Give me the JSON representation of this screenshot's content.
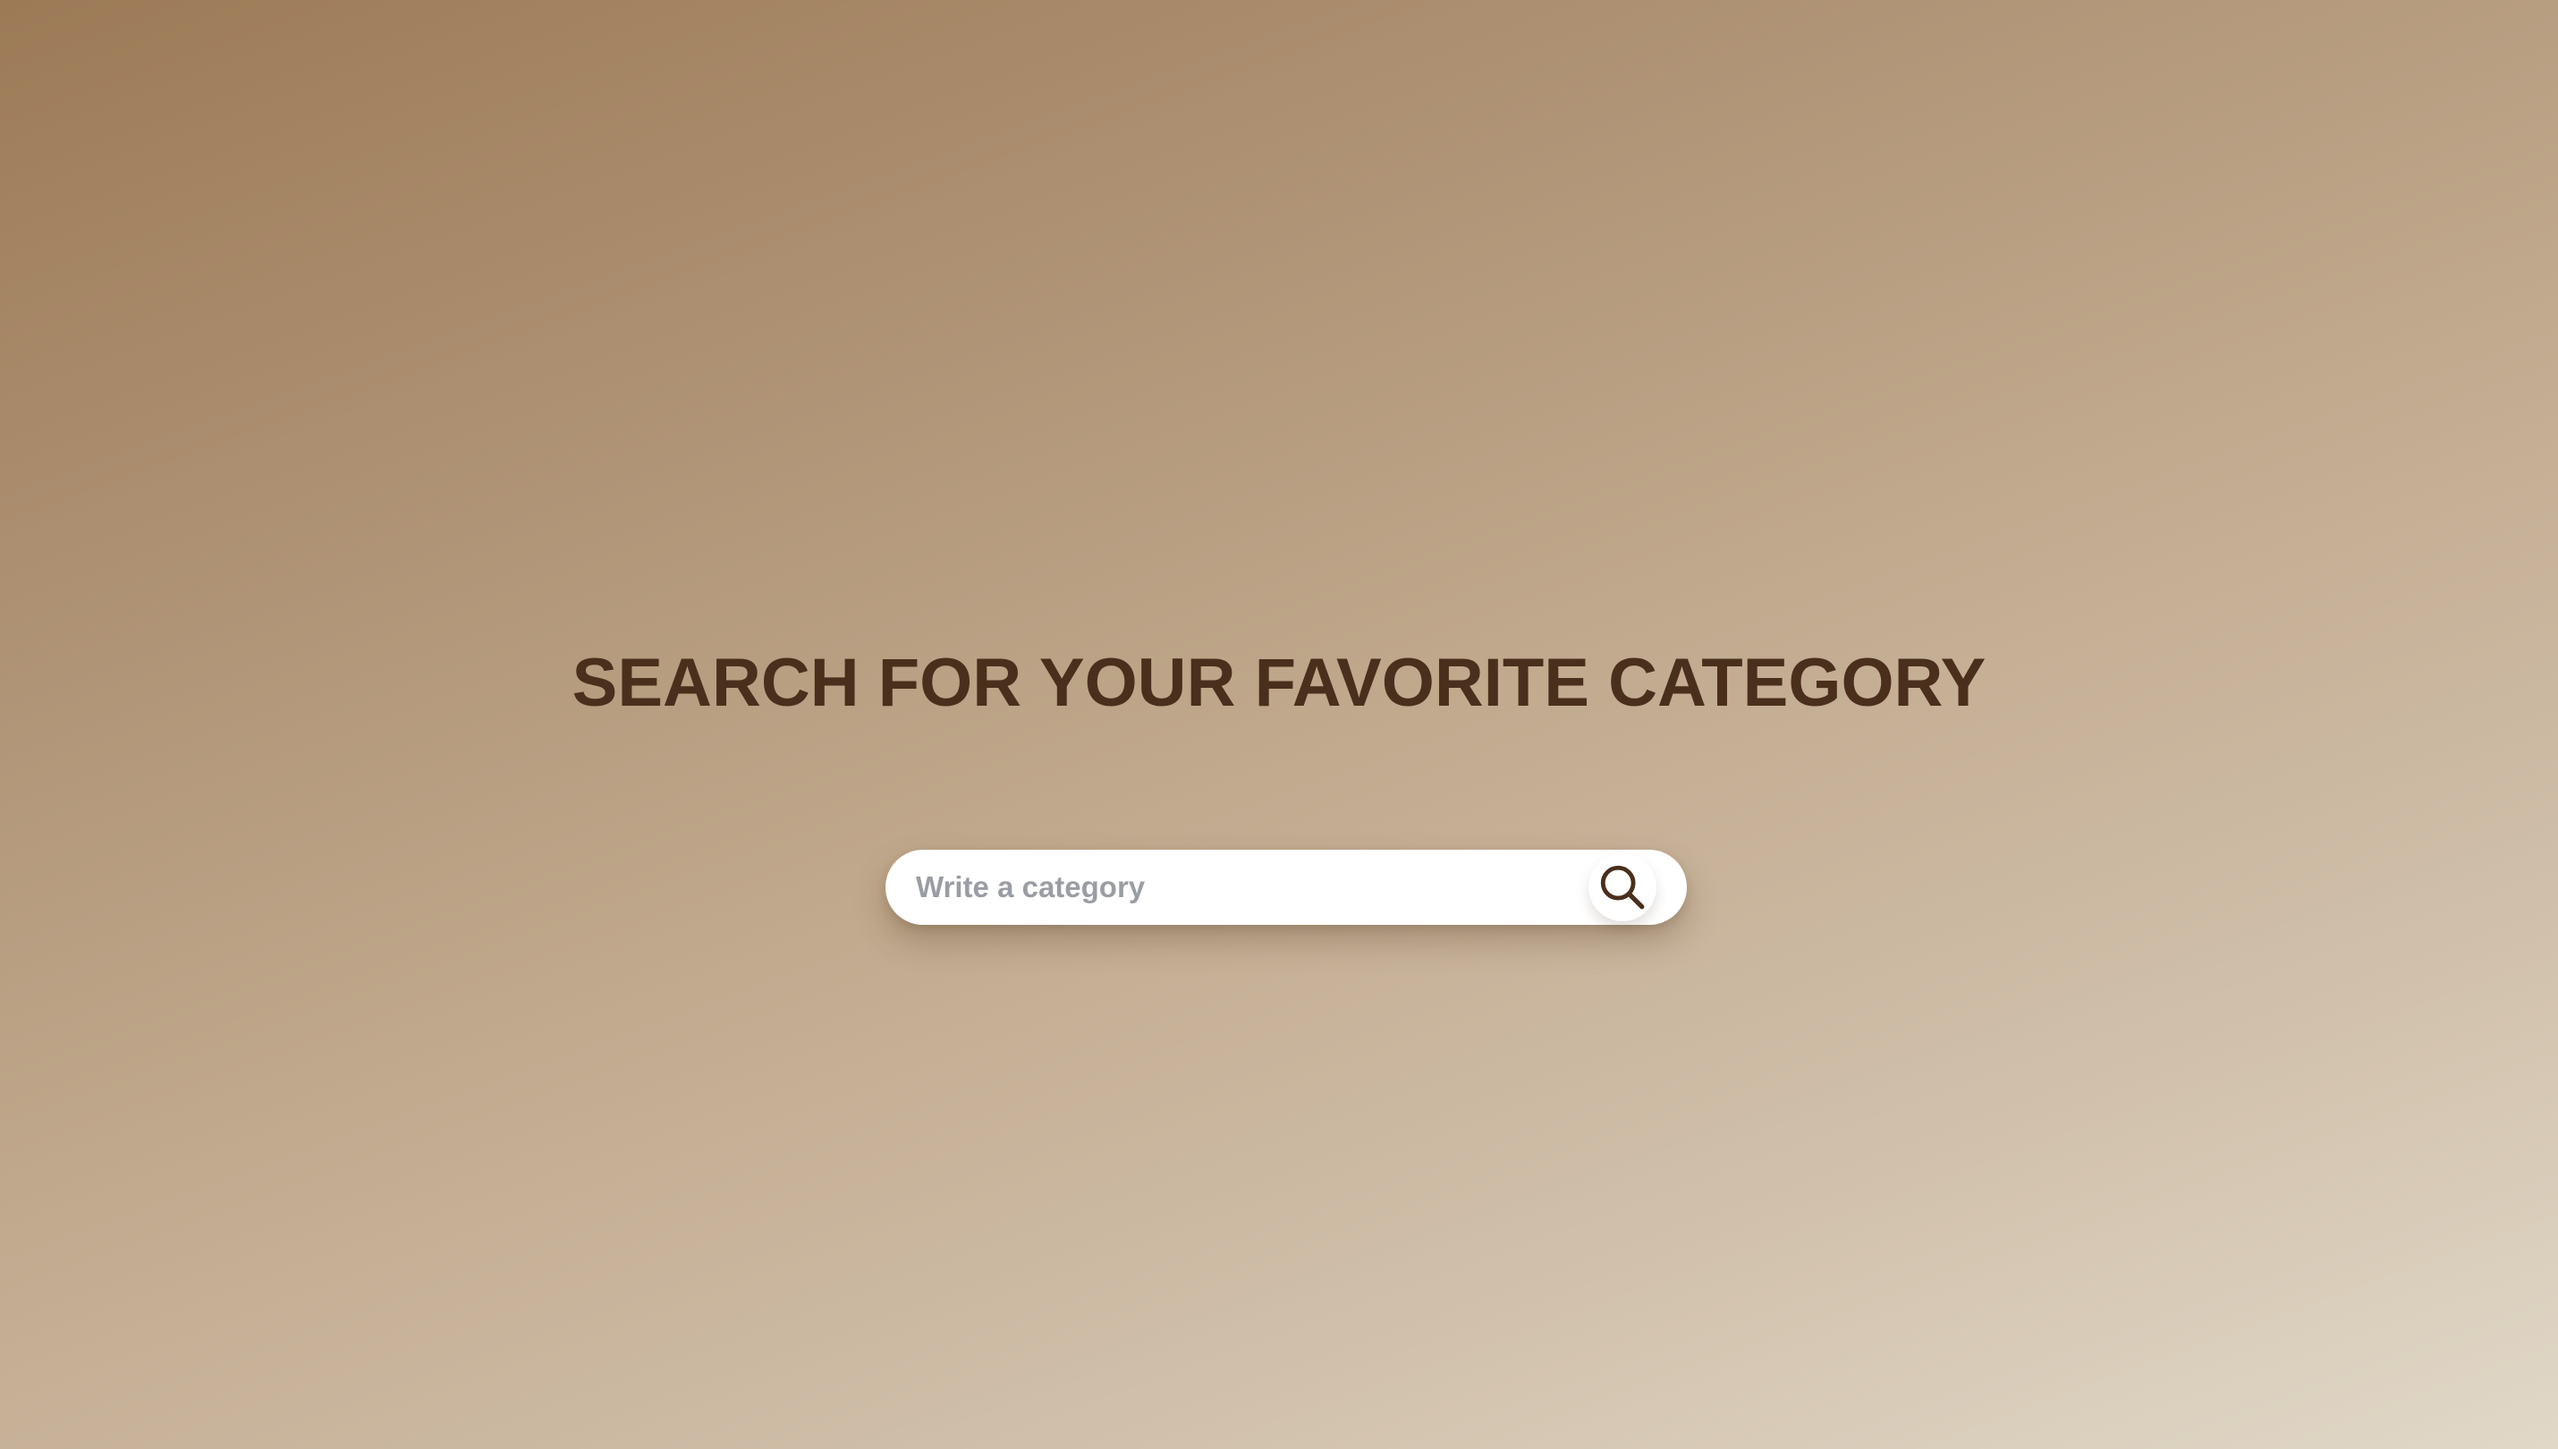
{
  "page": {
    "headline": "SEARCH FOR YOUR FAVORITE CATEGORY"
  },
  "search": {
    "placeholder": "Write a category",
    "value": "",
    "button_icon": "search-icon"
  },
  "colors": {
    "text_primary": "#4a2f1c",
    "placeholder": "#9a9da3",
    "input_background": "#ffffff",
    "background_gradient_start": "#9c7a56",
    "background_gradient_end": "#e1d8c8"
  }
}
